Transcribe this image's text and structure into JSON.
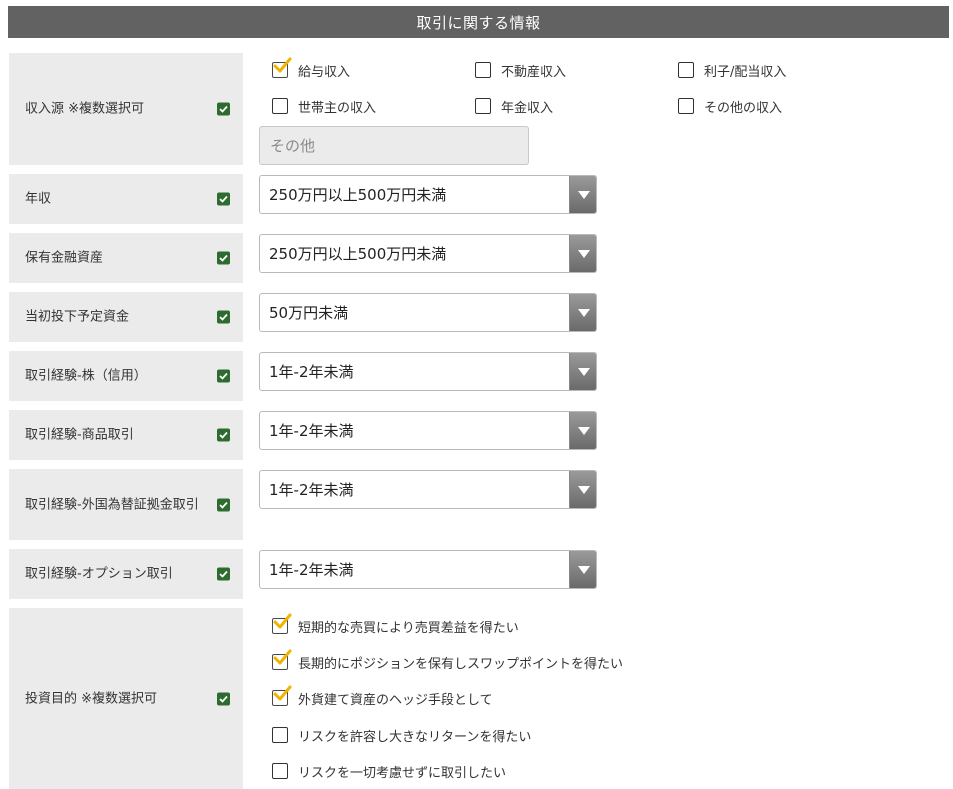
{
  "header": {
    "title": "取引に関する情報"
  },
  "income_source": {
    "label": "収入源 ※複数選択可",
    "options": [
      {
        "label": "給与収入",
        "checked": true
      },
      {
        "label": "不動産収入",
        "checked": false
      },
      {
        "label": "利子/配当収入",
        "checked": false
      },
      {
        "label": "世帯主の収入",
        "checked": false
      },
      {
        "label": "年金収入",
        "checked": false
      },
      {
        "label": "その他の収入",
        "checked": false
      }
    ],
    "other_placeholder": "その他"
  },
  "selects": [
    {
      "label": "年収",
      "value": "250万円以上500万円未満"
    },
    {
      "label": "保有金融資産",
      "value": "250万円以上500万円未満"
    },
    {
      "label": "当初投下予定資金",
      "value": "50万円未満"
    },
    {
      "label": "取引経験-株（信用）",
      "value": "1年-2年未満"
    },
    {
      "label": "取引経験-商品取引",
      "value": "1年-2年未満"
    },
    {
      "label": "取引経験-外国為替証拠金取引",
      "value": "1年-2年未満"
    },
    {
      "label": "取引経験-オプション取引",
      "value": "1年-2年未満"
    }
  ],
  "purpose": {
    "label": "投資目的 ※複数選択可",
    "options": [
      {
        "label": "短期的な売買により売買差益を得たい",
        "checked": true
      },
      {
        "label": "長期的にポジションを保有しスワップポイントを得たい",
        "checked": true
      },
      {
        "label": "外貨建て資産のヘッジ手段として",
        "checked": true
      },
      {
        "label": "リスクを許容し大きなリターンを得たい",
        "checked": false
      },
      {
        "label": "リスクを一切考慮せずに取引したい",
        "checked": false
      }
    ]
  },
  "colors": {
    "header_bg": "#626262",
    "label_bg": "#ebebeb",
    "required_check": "#2e6b2e",
    "checkmark": "#f0b400"
  }
}
